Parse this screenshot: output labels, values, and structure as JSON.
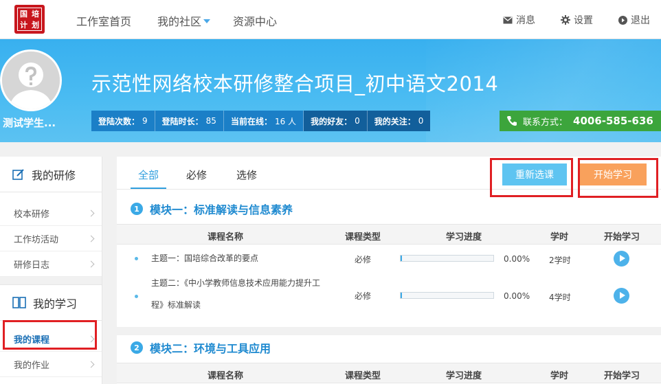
{
  "nav": {
    "logo_chars": [
      "国",
      "培",
      "计",
      "划"
    ],
    "links": [
      "工作室首页",
      "我的社区",
      "资源中心"
    ],
    "messages": "消息",
    "settings": "设置",
    "logout": "退出"
  },
  "banner": {
    "username": "测试学生...",
    "project_title": "示范性网络校本研修整合项目_初中语文2014",
    "stats": [
      {
        "label": "登陆次数：",
        "value": "9"
      },
      {
        "label": "登陆时长：",
        "value": "85"
      },
      {
        "label": "当前在线：",
        "value": "16 人"
      },
      {
        "label": "我的好友：",
        "value": "0"
      },
      {
        "label": "我的关注：",
        "value": "0"
      }
    ],
    "contact_label": "联系方式：",
    "contact_number": "4006-585-636"
  },
  "sidebar": {
    "section1": "我的研修",
    "section1_items": [
      "校本研修",
      "工作坊活动",
      "研修日志"
    ],
    "section2": "我的学习",
    "section2_items": [
      "我的课程",
      "我的作业"
    ]
  },
  "main": {
    "tabs": [
      "全部",
      "必修",
      "选修"
    ],
    "reselect_label": "重新选课",
    "start_label": "开始学习",
    "columns": [
      "课程名称",
      "课程类型",
      "学习进度",
      "学时",
      "开始学习"
    ],
    "modules": [
      {
        "num": "1",
        "title": "模块一：标准解读与信息素养",
        "rows": [
          {
            "name": "主题一：国培综合改革的要点",
            "type": "必修",
            "progress": 0.0,
            "pct": "0.00%",
            "hours": "2学时"
          },
          {
            "name_line1": "主题二：《中小学教师信息技术应用能力提升工",
            "name_line2": "程》标准解读",
            "type": "必修",
            "progress": 0.0,
            "pct": "0.00%",
            "hours": "4学时"
          }
        ]
      },
      {
        "num": "2",
        "title": "模块二：环境与工具应用"
      }
    ]
  },
  "colors": {
    "banner": "#38b0ef",
    "accent": "#2f9ede",
    "start_button": "#f9a15c",
    "reselect_button": "#5ec4f1",
    "contact": "#3ca53c",
    "highlight_box": "#e01f23"
  }
}
